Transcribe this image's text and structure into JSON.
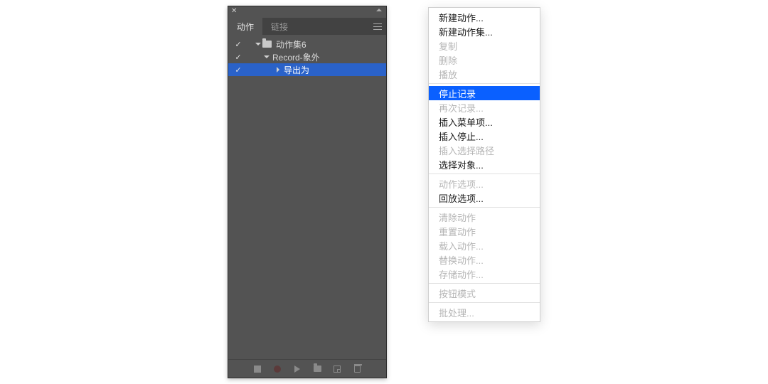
{
  "panel": {
    "tabs": [
      {
        "label": "动作",
        "active": true
      },
      {
        "label": "链接",
        "active": false
      }
    ],
    "tree": {
      "set": {
        "label": "动作集6"
      },
      "action": {
        "label": "Record-象外"
      },
      "step": {
        "label": "导出为"
      }
    },
    "footer_icons": [
      "stop",
      "record",
      "play",
      "new-set",
      "new-action",
      "trash"
    ]
  },
  "menu": {
    "groups": [
      [
        {
          "label": "新建动作...",
          "state": "enabled"
        },
        {
          "label": "新建动作集...",
          "state": "enabled"
        },
        {
          "label": "复制",
          "state": "disabled"
        },
        {
          "label": "删除",
          "state": "disabled"
        },
        {
          "label": "播放",
          "state": "disabled"
        }
      ],
      [
        {
          "label": "停止记录",
          "state": "highlight"
        },
        {
          "label": "再次记录...",
          "state": "disabled"
        },
        {
          "label": "插入菜单项...",
          "state": "enabled"
        },
        {
          "label": "插入停止...",
          "state": "enabled"
        },
        {
          "label": "插入选择路径",
          "state": "disabled"
        },
        {
          "label": "选择对象...",
          "state": "enabled"
        }
      ],
      [
        {
          "label": "动作选项...",
          "state": "disabled"
        },
        {
          "label": "回放选项...",
          "state": "enabled"
        }
      ],
      [
        {
          "label": "清除动作",
          "state": "disabled"
        },
        {
          "label": "重置动作",
          "state": "disabled"
        },
        {
          "label": "载入动作...",
          "state": "disabled"
        },
        {
          "label": "替换动作...",
          "state": "disabled"
        },
        {
          "label": "存储动作...",
          "state": "disabled"
        }
      ],
      [
        {
          "label": "按钮模式",
          "state": "disabled"
        }
      ],
      [
        {
          "label": "批处理...",
          "state": "disabled"
        }
      ]
    ]
  }
}
